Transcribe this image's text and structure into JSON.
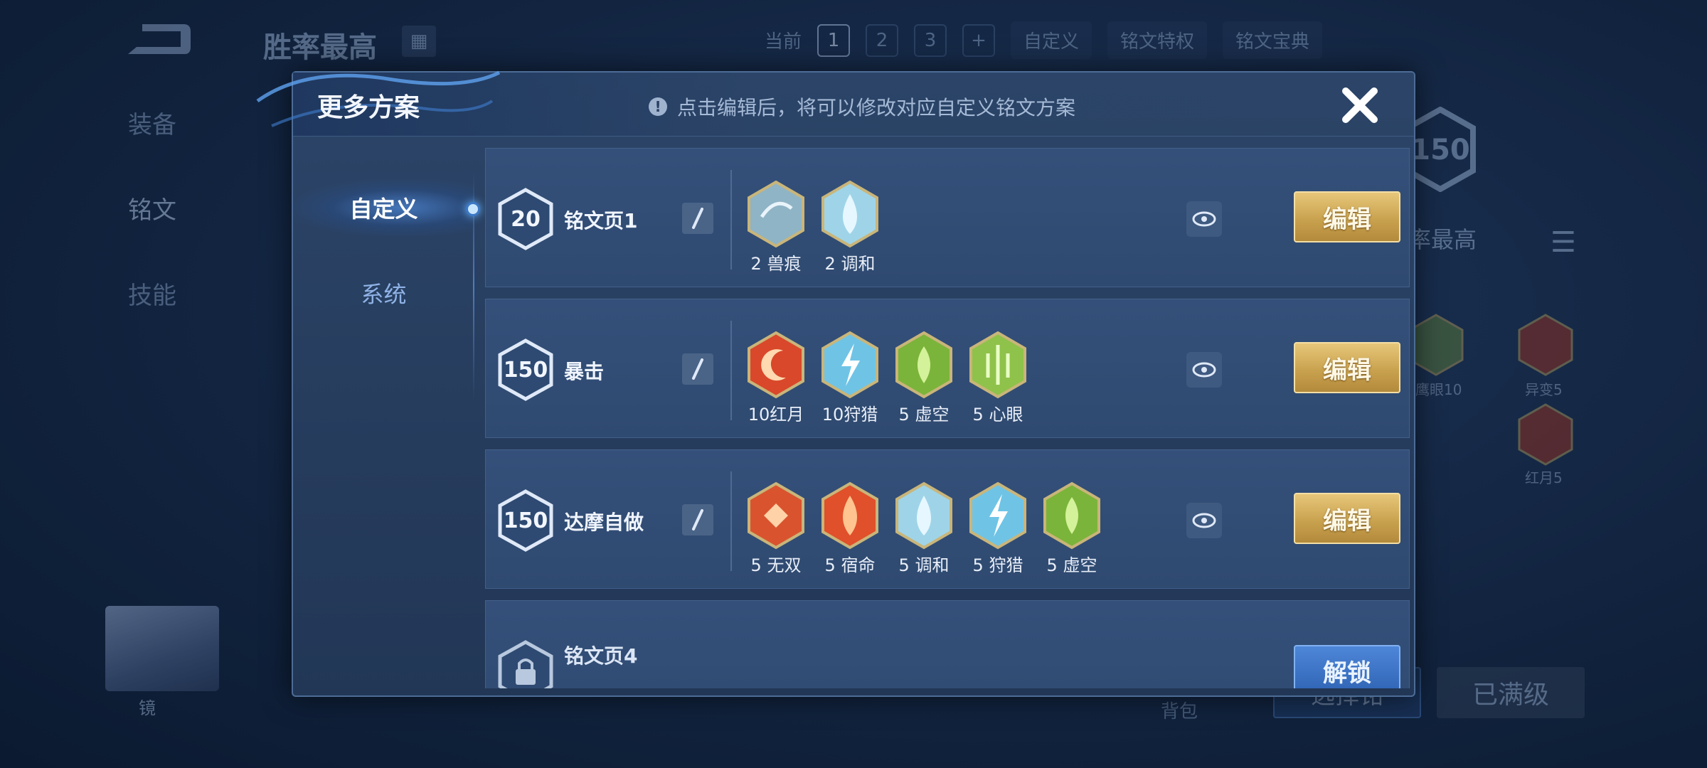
{
  "background": {
    "title": "胜率最高",
    "topbar": {
      "current_label": "当前",
      "pages": [
        "1",
        "2",
        "3"
      ],
      "add": "+",
      "custom": "自定义",
      "privilege": "铭文特权",
      "codex": "铭文宝典"
    },
    "side_tabs": [
      "装备",
      "铭文",
      "技能"
    ],
    "level": "150",
    "rate_label": "率最高",
    "runes": [
      {
        "label": "鹰眼10"
      },
      {
        "label": "异变5"
      },
      {
        "label": "红月5"
      }
    ],
    "avatar_name": "镜",
    "bag_label": "背包",
    "select_button": "选择铭",
    "maxed_button": "已满级"
  },
  "modal": {
    "title": "更多方案",
    "hint": "点击编辑后，将可以修改对应自定义铭文方案",
    "tabs": {
      "custom": "自定义",
      "system": "系统"
    },
    "rows": [
      {
        "level": "20",
        "name": "铭文页1",
        "edit": "编辑",
        "runes": [
          {
            "label": "2 兽痕",
            "color": "#8fb4c6"
          },
          {
            "label": "2 调和",
            "color": "#9fd4e8"
          }
        ]
      },
      {
        "level": "150",
        "name": "暴击",
        "edit": "编辑",
        "runes": [
          {
            "label": "10红月",
            "color": "#d9482a"
          },
          {
            "label": "10狩猎",
            "color": "#6fc4e6"
          },
          {
            "label": "5 虚空",
            "color": "#7bb43a"
          },
          {
            "label": "5 心眼",
            "color": "#8fc24a"
          }
        ]
      },
      {
        "level": "150",
        "name": "达摩自做",
        "edit": "编辑",
        "runes": [
          {
            "label": "5 无双",
            "color": "#d9542e"
          },
          {
            "label": "5 宿命",
            "color": "#e0502a"
          },
          {
            "label": "5 调和",
            "color": "#9fd4e8"
          },
          {
            "label": "5 狩猎",
            "color": "#6fc4e6"
          },
          {
            "label": "5 虚空",
            "color": "#7bb43a"
          }
        ]
      }
    ],
    "locked_row": {
      "name": "铭文页4",
      "unlock": "解锁"
    }
  },
  "colors": {
    "gold_button": "#c9a24f",
    "panel": "#2c4568",
    "accent_blue": "#67b4ff"
  }
}
